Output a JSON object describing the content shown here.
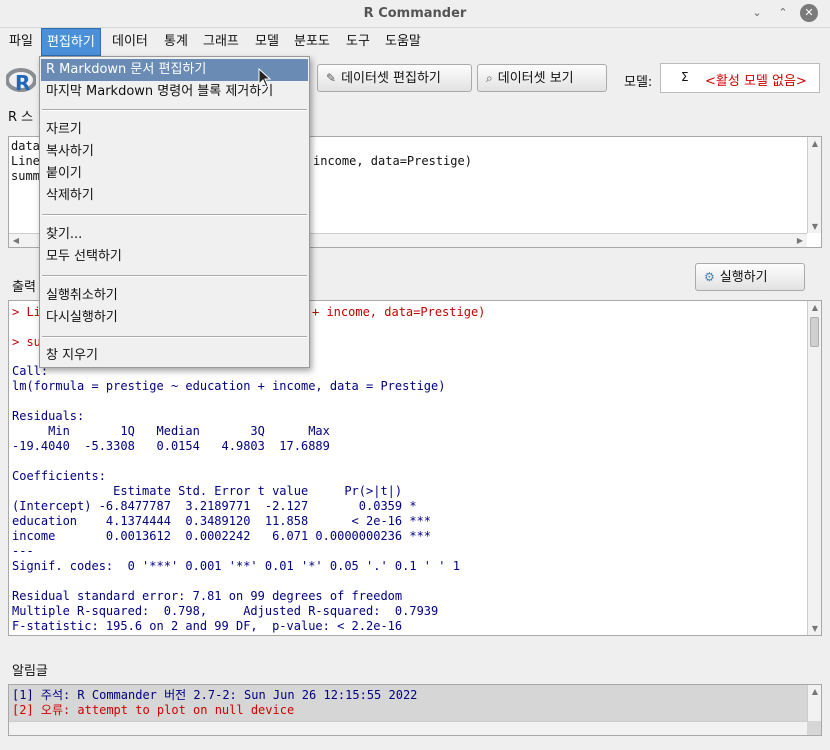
{
  "window": {
    "title": "R Commander",
    "controls": {
      "minimize": "⌄",
      "maximize": "⌃",
      "close": "✕"
    }
  },
  "menubar": [
    "파일",
    "편집하기",
    "데이터",
    "통계",
    "그래프",
    "모델",
    "분포도",
    "도구",
    "도움말"
  ],
  "toolbar": {
    "edit_dataset": "데이터셋 편집하기",
    "view_dataset": "데이터셋 보기",
    "model_label": "모델:",
    "model_sigma": "Σ",
    "model_value": "<활성 모델 없음>"
  },
  "script": {
    "label_visible": "R 스",
    "lines_left": [
      "data",
      "Line",
      "summ"
    ],
    "line2_right": "income, data=Prestige)"
  },
  "output": {
    "label_visible": "출력",
    "run_button": "실행하기",
    "cmd1_left": "> Li",
    "cmd1_right": "+ income, data=Prestige)",
    "cmd2_left": "> su",
    "lines": [
      "Call:",
      "lm(formula = prestige ~ education + income, data = Prestige)",
      "",
      "Residuals:",
      "     Min       1Q   Median       3Q      Max ",
      "-19.4040  -5.3308   0.0154   4.9803  17.6889 ",
      "",
      "Coefficients:",
      "              Estimate Std. Error t value     Pr(>|t|)    ",
      "(Intercept) -6.8477787  3.2189771  -2.127       0.0359 *  ",
      "education    4.1374444  0.3489120  11.858      < 2e-16 ***",
      "income       0.0013612  0.0002242   6.071 0.0000000236 ***",
      "---",
      "Signif. codes:  0 '***' 0.001 '**' 0.01 '*' 0.05 '.' 0.1 ' ' 1",
      "",
      "Residual standard error: 7.81 on 99 degrees of freedom",
      "Multiple R-squared:  0.798,\tAdjusted R-squared:  0.7939 ",
      "F-statistic: 195.6 on 2 and 99 DF,  p-value: < 2.2e-16"
    ]
  },
  "messages": {
    "label": "알림글",
    "note": "[1] 주석: R Commander 버전 2.7-2: Sun Jun 26 12:15:55 2022",
    "error": "[2] 오류: attempt to plot on null device"
  },
  "edit_menu": {
    "items": [
      "R Markdown 문서 편집하기",
      "마지막 Markdown 명령어 블록 제거하기",
      "자르기",
      "복사하기",
      "붙이기",
      "삭제하기",
      "찾기...",
      "모두 선택하기",
      "실행취소하기",
      "다시실행하기",
      "창 지우기"
    ]
  },
  "colors": {
    "menu_highlight": "#6a8bb4",
    "menubar_active": "#4a90d9",
    "command_red": "#c00000",
    "output_blue": "#000080"
  }
}
